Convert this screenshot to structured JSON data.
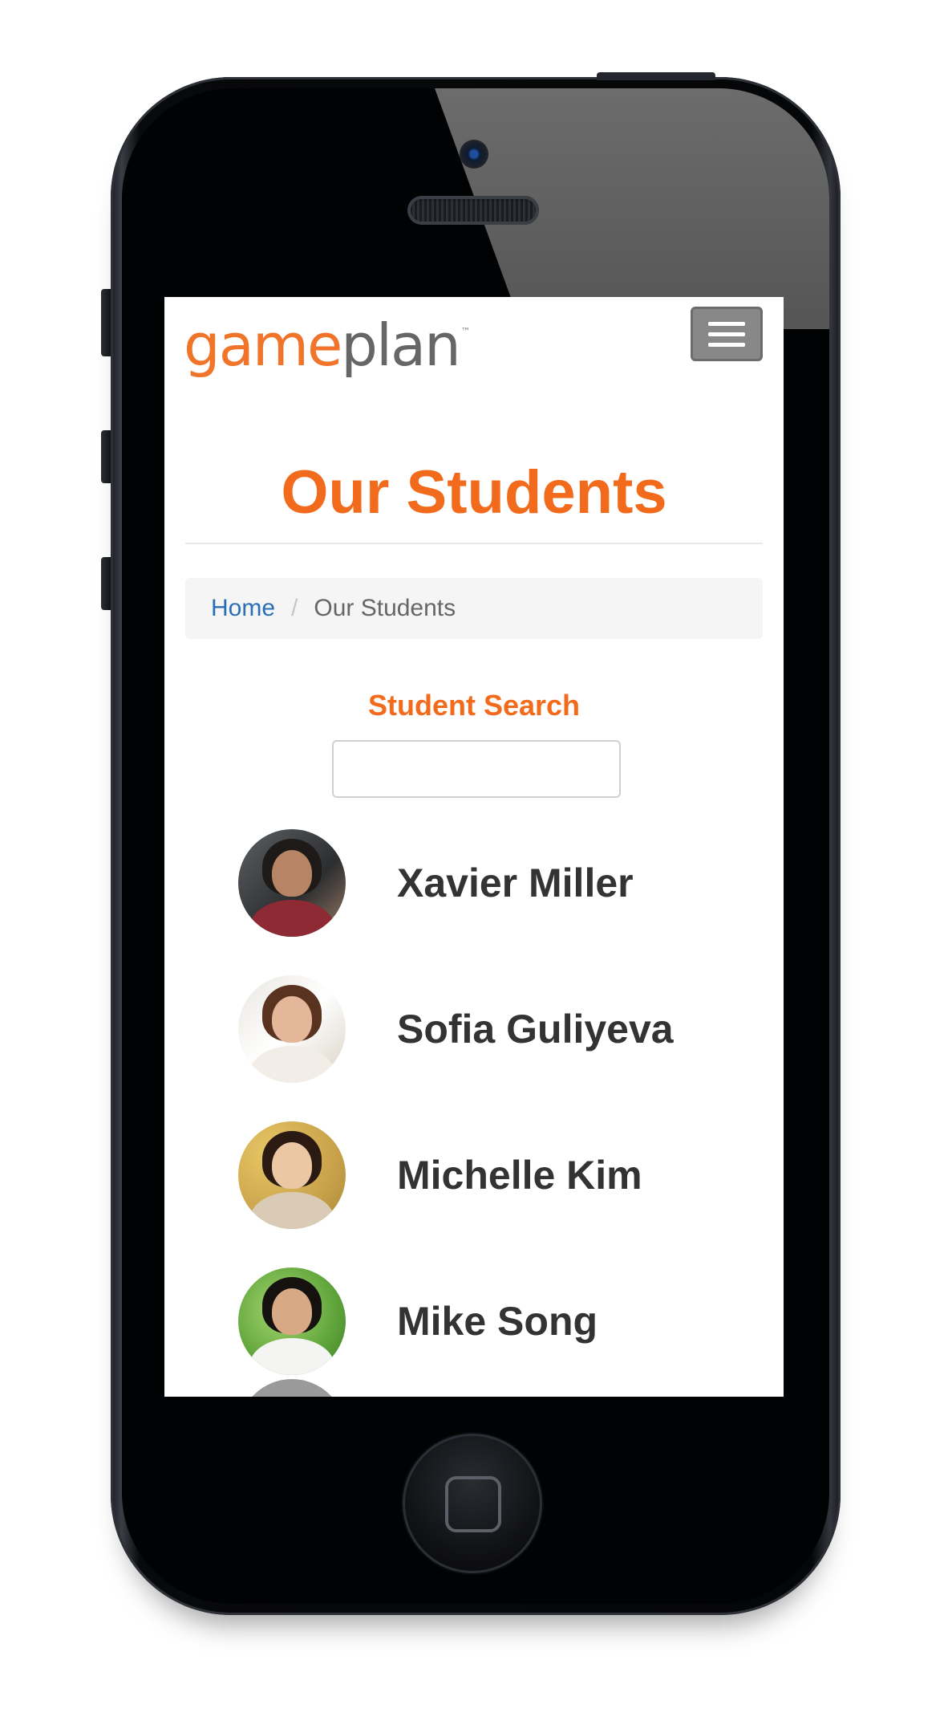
{
  "app": {
    "logo_part1": "game",
    "logo_part2": "plan",
    "logo_tm": "™"
  },
  "page": {
    "title": "Our Students"
  },
  "breadcrumb": {
    "home": "Home",
    "separator": "/",
    "current": "Our Students"
  },
  "search": {
    "label": "Student Search",
    "value": "",
    "placeholder": ""
  },
  "students": [
    {
      "name": "Xavier Miller",
      "avatar": "avatar-photo"
    },
    {
      "name": "Sofia Guliyeva",
      "avatar": "avatar-photo"
    },
    {
      "name": "Michelle Kim",
      "avatar": "avatar-photo"
    },
    {
      "name": "Mike Song",
      "avatar": "avatar-photo"
    }
  ],
  "icons": {
    "menu": "hamburger-menu-icon",
    "search": "search-icon",
    "home_button": "home-button-icon"
  },
  "colors": {
    "accent": "#f26a1b",
    "link": "#2a6fb5",
    "text": "#333333"
  }
}
